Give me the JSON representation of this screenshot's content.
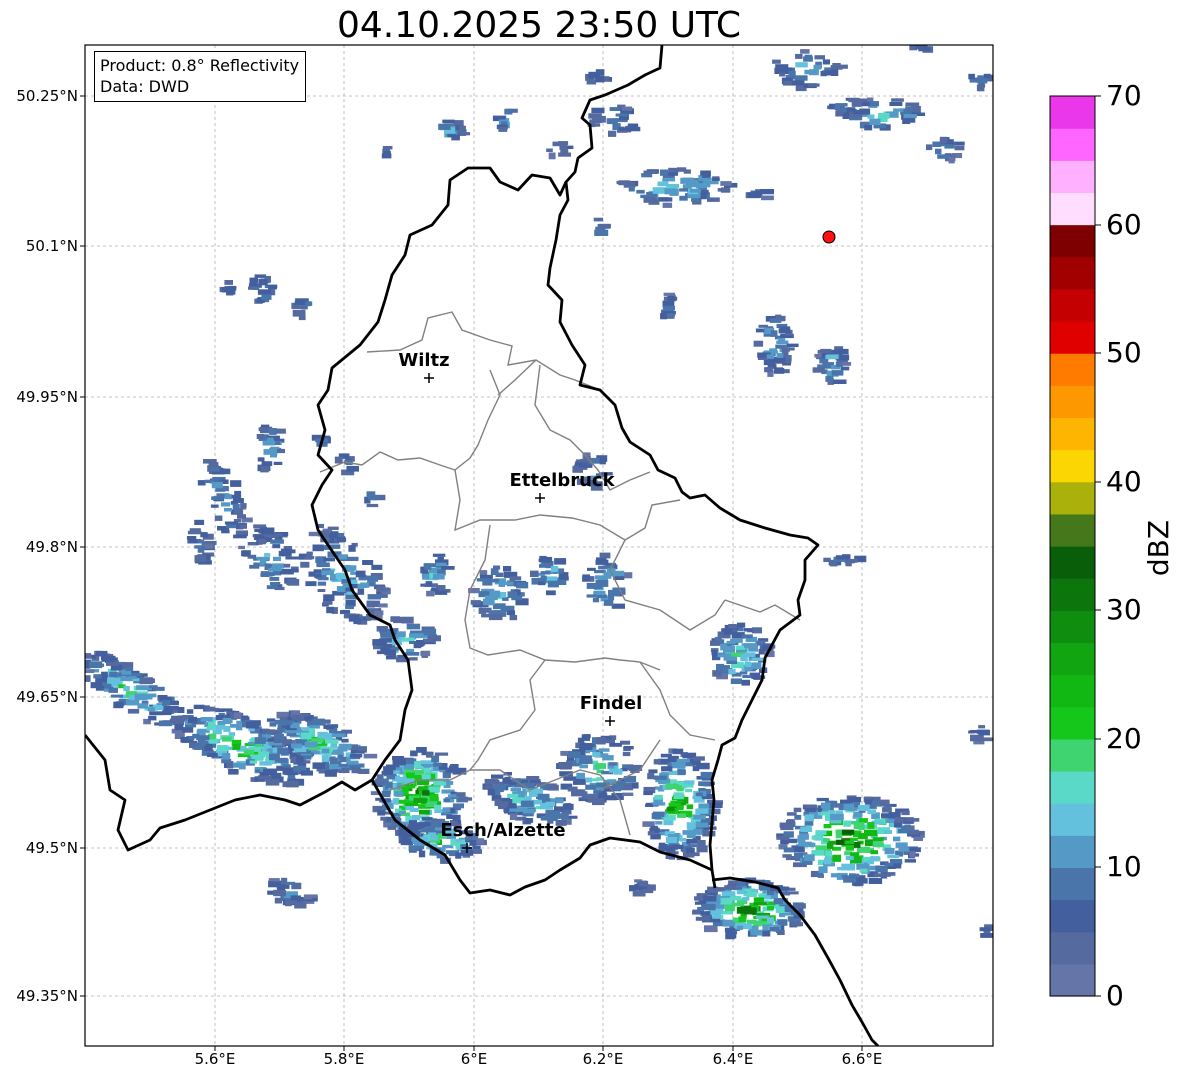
{
  "title": "04.10.2025 23:50 UTC",
  "info_box": {
    "product": "Product: 0.8° Reflectivity",
    "data": "Data: DWD"
  },
  "y_ticks": [
    "50.25°N",
    "50.1°N",
    "49.95°N",
    "49.8°N",
    "49.65°N",
    "49.5°N",
    "49.35°N"
  ],
  "x_ticks": [
    "5.6°E",
    "5.8°E",
    "6°E",
    "6.2°E",
    "6.4°E",
    "6.6°E"
  ],
  "cities": [
    {
      "name": "Wiltz"
    },
    {
      "name": "Ettelbruck"
    },
    {
      "name": "Findel"
    },
    {
      "name": "Esch/Alzette"
    }
  ],
  "colorbar": {
    "label": "dBZ",
    "ticks": [
      "70",
      "60",
      "50",
      "40",
      "30",
      "20",
      "10",
      "0"
    ],
    "range": [
      0,
      70
    ],
    "step": 2.5,
    "colors": [
      "#6675a8",
      "#556a9f",
      "#445f9e",
      "#4a75aa",
      "#559ac6",
      "#63c1de",
      "#5ad8c8",
      "#3fd46f",
      "#14c71a",
      "#11b814",
      "#10a511",
      "#0e8d0e",
      "#0c760c",
      "#095f09",
      "#44781a",
      "#aab10a",
      "#fcd602",
      "#fdb501",
      "#fe9801",
      "#ff7b00",
      "#e00000",
      "#c40000",
      "#a10000",
      "#7e0000",
      "#ffddff",
      "#ffb1ff",
      "#ff66ff",
      "#ea37ea"
    ]
  },
  "colors": {
    "country_border": "#000000",
    "canton_border": "#808080",
    "grid": "#b0b0b0",
    "marker": "#ff1111"
  }
}
